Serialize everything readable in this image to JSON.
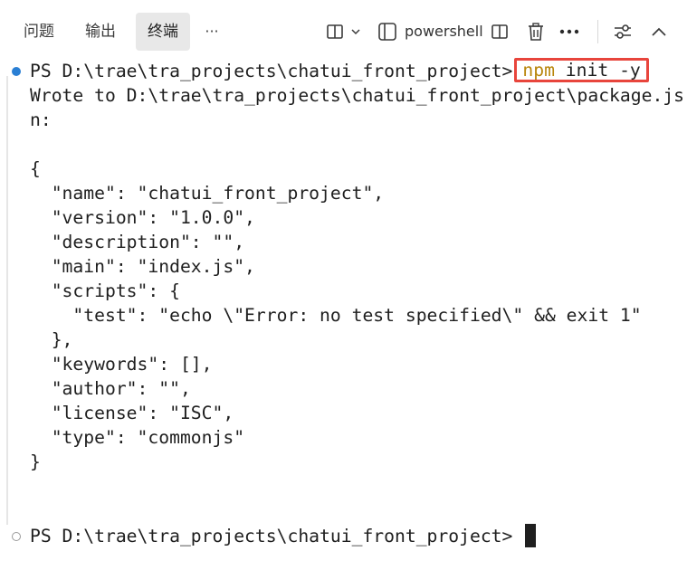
{
  "panel": {
    "tabs": [
      {
        "label": "问题",
        "active": false
      },
      {
        "label": "输出",
        "active": false
      },
      {
        "label": "终端",
        "active": true
      },
      {
        "label": "···",
        "active": false
      }
    ],
    "shell_name": "powershell",
    "icons": [
      "split-layout-icon",
      "chevron-down-icon",
      "terminal-panel-icon",
      "split-terminal-icon",
      "trash-icon",
      "more-actions-icon",
      "settings-sliders-icon",
      "chevron-up-icon"
    ]
  },
  "terminal": {
    "prompt_1": "PS D:\\trae\\tra_projects\\chatui_front_project>",
    "command": {
      "npm": "npm",
      "rest": " init -y"
    },
    "output": [
      "Wrote to D:\\trae\\tra_projects\\chatui_front_project\\package.js",
      "n:",
      "",
      "{",
      "  \"name\": \"chatui_front_project\",",
      "  \"version\": \"1.0.0\",",
      "  \"description\": \"\",",
      "  \"main\": \"index.js\",",
      "  \"scripts\": {",
      "    \"test\": \"echo \\\"Error: no test specified\\\" && exit 1\"",
      "  },",
      "  \"keywords\": [],",
      "  \"author\": \"\",",
      "  \"license\": \"ISC\",",
      "  \"type\": \"commonjs\"",
      "}"
    ],
    "prompt_2": "PS D:\\trae\\tra_projects\\chatui_front_project>"
  },
  "colors": {
    "highlight_border": "#e8453c",
    "success_decoration": "#2a7fd4",
    "active_tab_bg": "#e8e8e8"
  }
}
